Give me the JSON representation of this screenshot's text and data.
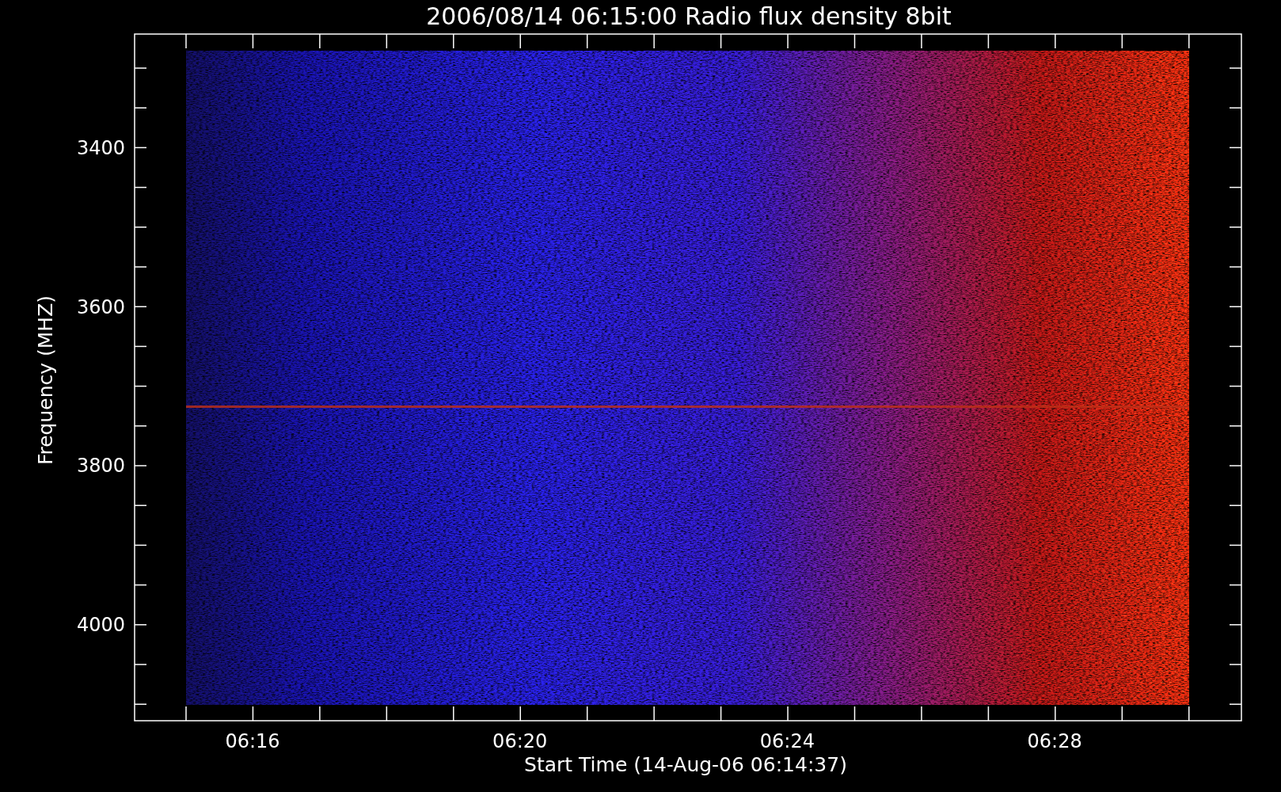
{
  "title": "2006/08/14 06:15:00 Radio flux density 8bit",
  "y_axis": {
    "label": "Frequency (MHZ)",
    "ticks": [
      "3400",
      "3600",
      "3800",
      "4000"
    ]
  },
  "x_axis": {
    "label": "Start Time (14-Aug-06 06:14:37)",
    "ticks": [
      "06:16",
      "06:20",
      "06:24",
      "06:28"
    ]
  }
}
